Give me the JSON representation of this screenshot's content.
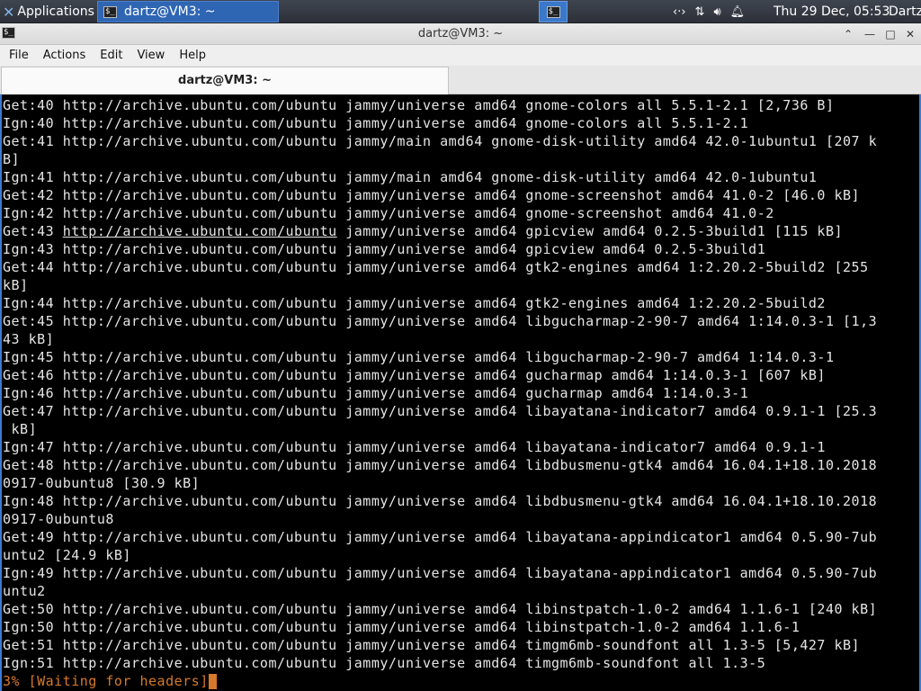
{
  "panel": {
    "applications_label": "Applications",
    "task_title": "dartz@VM3: ~",
    "clock": "Thu 29 Dec, 05:53",
    "user": "Dartz",
    "tray_icons": [
      "network-code-icon",
      "network-arrows-icon",
      "volume-icon",
      "bell-icon"
    ]
  },
  "window": {
    "title": "dartz@VM3: ~",
    "controls": {
      "shade": "⌃",
      "minimize": "—",
      "maximize": "□",
      "close": "✕"
    }
  },
  "menubar": [
    "File",
    "Actions",
    "Edit",
    "View",
    "Help"
  ],
  "tab": {
    "label": "dartz@VM3: ~"
  },
  "terminal": {
    "lines": [
      "Get:40 http://archive.ubuntu.com/ubuntu jammy/universe amd64 gnome-colors all 5.5.1-2.1 [2,736 B]",
      "Ign:40 http://archive.ubuntu.com/ubuntu jammy/universe amd64 gnome-colors all 5.5.1-2.1",
      "Get:41 http://archive.ubuntu.com/ubuntu jammy/main amd64 gnome-disk-utility amd64 42.0-1ubuntu1 [207 k",
      "B]",
      "Ign:41 http://archive.ubuntu.com/ubuntu jammy/main amd64 gnome-disk-utility amd64 42.0-1ubuntu1",
      "Get:42 http://archive.ubuntu.com/ubuntu jammy/universe amd64 gnome-screenshot amd64 41.0-2 [46.0 kB]",
      "Ign:42 http://archive.ubuntu.com/ubuntu jammy/universe amd64 gnome-screenshot amd64 41.0-2",
      "Get:43 http://archive.ubuntu.com/ubuntu jammy/universe amd64 gpicview amd64 0.2.5-3build1 [115 kB]",
      "Ign:43 http://archive.ubuntu.com/ubuntu jammy/universe amd64 gpicview amd64 0.2.5-3build1",
      "Get:44 http://archive.ubuntu.com/ubuntu jammy/universe amd64 gtk2-engines amd64 1:2.20.2-5build2 [255",
      "kB]",
      "Ign:44 http://archive.ubuntu.com/ubuntu jammy/universe amd64 gtk2-engines amd64 1:2.20.2-5build2",
      "Get:45 http://archive.ubuntu.com/ubuntu jammy/universe amd64 libgucharmap-2-90-7 amd64 1:14.0.3-1 [1,3",
      "43 kB]",
      "Ign:45 http://archive.ubuntu.com/ubuntu jammy/universe amd64 libgucharmap-2-90-7 amd64 1:14.0.3-1",
      "Get:46 http://archive.ubuntu.com/ubuntu jammy/universe amd64 gucharmap amd64 1:14.0.3-1 [607 kB]",
      "Ign:46 http://archive.ubuntu.com/ubuntu jammy/universe amd64 gucharmap amd64 1:14.0.3-1",
      "Get:47 http://archive.ubuntu.com/ubuntu jammy/universe amd64 libayatana-indicator7 amd64 0.9.1-1 [25.3",
      " kB]",
      "Ign:47 http://archive.ubuntu.com/ubuntu jammy/universe amd64 libayatana-indicator7 amd64 0.9.1-1",
      "Get:48 http://archive.ubuntu.com/ubuntu jammy/universe amd64 libdbusmenu-gtk4 amd64 16.04.1+18.10.2018",
      "0917-0ubuntu8 [30.9 kB]",
      "Ign:48 http://archive.ubuntu.com/ubuntu jammy/universe amd64 libdbusmenu-gtk4 amd64 16.04.1+18.10.2018",
      "0917-0ubuntu8",
      "Get:49 http://archive.ubuntu.com/ubuntu jammy/universe amd64 libayatana-appindicator1 amd64 0.5.90-7ub",
      "untu2 [24.9 kB]",
      "Ign:49 http://archive.ubuntu.com/ubuntu jammy/universe amd64 libayatana-appindicator1 amd64 0.5.90-7ub",
      "untu2",
      "Get:50 http://archive.ubuntu.com/ubuntu jammy/universe amd64 libinstpatch-1.0-2 amd64 1.1.6-1 [240 kB]",
      "Ign:50 http://archive.ubuntu.com/ubuntu jammy/universe amd64 libinstpatch-1.0-2 amd64 1.1.6-1",
      "Get:51 http://archive.ubuntu.com/ubuntu jammy/universe amd64 timgm6mb-soundfont all 1.3-5 [5,427 kB]",
      "Ign:51 http://archive.ubuntu.com/ubuntu jammy/universe amd64 timgm6mb-soundfont all 1.3-5"
    ],
    "status": "3% [Waiting for headers]",
    "colors": {
      "status": "#d6792a",
      "text": "#e5e5e5",
      "background": "#000000",
      "accent": "#3a7bd5"
    }
  }
}
